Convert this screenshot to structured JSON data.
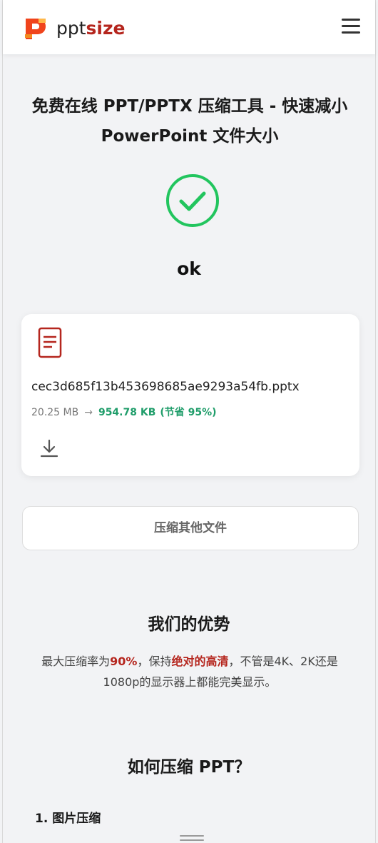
{
  "header": {
    "brand_prefix": "ppt",
    "brand_suffix": "size",
    "menu_icon": "hamburger-icon"
  },
  "main": {
    "title": "免费在线 PPT/PPTX 压缩工具 - 快速减小 PowerPoint 文件大小",
    "status_icon": "check-circle-icon",
    "status_text": "ok"
  },
  "result_card": {
    "file_icon": "document-icon",
    "file_name": "cec3d685f13b453698685ae9293a54fb.pptx",
    "original_size": "20.25 MB",
    "arrow": "→",
    "compressed_size": "954.78 KB",
    "saving": "(节省 95%)",
    "download_icon": "download-icon"
  },
  "compress_other_label": "压缩其他文件",
  "advantages": {
    "heading": "我们的优势",
    "text_part1": "最大压缩率为",
    "highlight1": "90%",
    "text_part2": "，保持",
    "highlight2": "绝对的高清",
    "text_part3": "，不管是4K、2K还是1080p的显示器上都能完美显示。"
  },
  "how_to": {
    "heading": "如何压缩 PPT？",
    "step1": "1. 图片压缩"
  },
  "colors": {
    "brand_red": "#b5261e",
    "success_green": "#22c55e",
    "saving_green": "#1f9d6a",
    "background": "#f2f3f5"
  }
}
